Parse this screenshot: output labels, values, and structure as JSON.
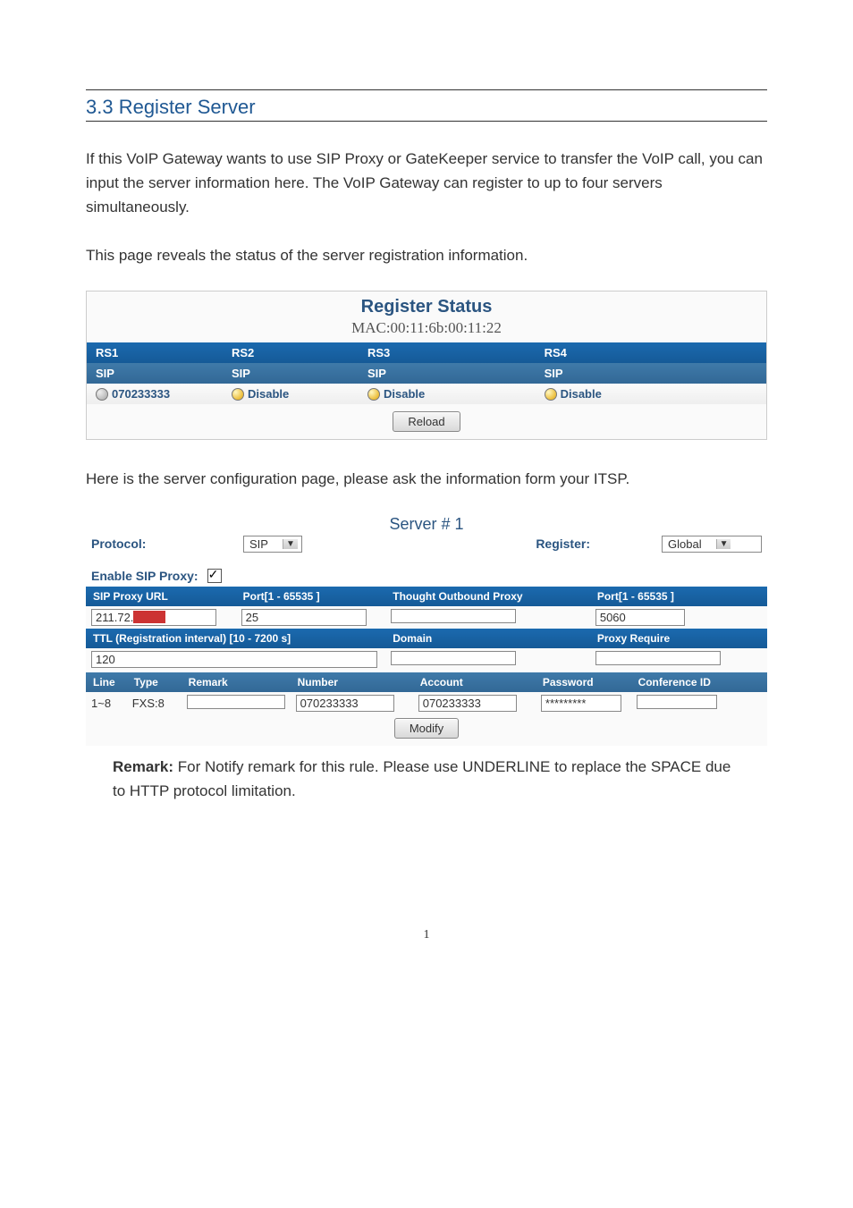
{
  "section": {
    "title": "3.3 Register Server",
    "para1": "If this VoIP Gateway wants to use SIP Proxy or GateKeeper service to transfer the VoIP call, you can input the server information here. The VoIP Gateway can register to up to four servers simultaneously.",
    "para2": "This page reveals the status of the server registration information.",
    "para3": "Here is the server configuration page, please ask the information form your ITSP.",
    "remark_label": "Remark:",
    "remark_text": " For Notify remark for this rule. Please use UNDERLINE to replace the SPACE due to HTTP protocol limitation."
  },
  "status": {
    "title": "Register Status",
    "mac_label": "MAC:00:11:6b:00:11:22",
    "cols": [
      "RS1",
      "RS2",
      "RS3",
      "RS4"
    ],
    "sip_row": [
      "SIP",
      "SIP",
      "SIP",
      "SIP"
    ],
    "val_row": [
      "070233333",
      "Disable",
      "Disable",
      "Disable"
    ],
    "reload": "Reload"
  },
  "server": {
    "title": "Server # 1",
    "protocol_label": "Protocol:",
    "protocol_value": "SIP",
    "register_label": "Register:",
    "register_value": "Global",
    "enable_proxy_label": "Enable SIP Proxy:",
    "headers1": {
      "proxy_url": "SIP Proxy URL",
      "port": "Port[1 - 65535 ]",
      "outbound": "Thought Outbound Proxy",
      "out_port": "Port[1 - 65535 ]"
    },
    "row1": {
      "proxy_url": "211.72.",
      "port": "25",
      "outbound": "",
      "out_port": "5060"
    },
    "headers2": {
      "ttl": "TTL (Registration interval) [10 - 7200 s]",
      "domain": "Domain",
      "proxy_require": "Proxy Require"
    },
    "row2": {
      "ttl": "120",
      "domain": "",
      "proxy_require": ""
    },
    "line_headers": {
      "line": "Line",
      "type": "Type",
      "remark": "Remark",
      "number": "Number",
      "account": "Account",
      "password": "Password",
      "conf": "Conference ID"
    },
    "line_row": {
      "line": "1~8",
      "type": "FXS:8",
      "remark": "",
      "number": "070233333",
      "account": "070233333",
      "password": "*********",
      "conf": ""
    },
    "modify": "Modify"
  },
  "page_number": "1"
}
